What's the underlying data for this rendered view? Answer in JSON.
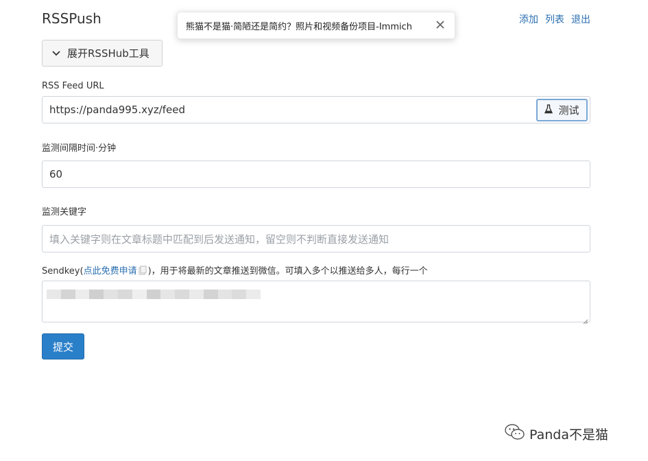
{
  "header": {
    "brand": "RSSPush",
    "nav": [
      "添加",
      "列表",
      "退出"
    ]
  },
  "toast": {
    "message": "熊猫不是猫·简陋还是简约？照片和视频备份项目-Immich"
  },
  "expand": {
    "label": "展开RSSHub工具"
  },
  "feed": {
    "label": "RSS Feed URL",
    "value": "https://panda995.xyz/feed",
    "test_label": "测试"
  },
  "interval": {
    "label": "监测间隔时间·分钟",
    "value": "60"
  },
  "keyword": {
    "label": "监测关键字",
    "placeholder": "填入关键字则在文章标题中匹配到后发送通知，留空则不判断直接发送通知"
  },
  "sendkey": {
    "label_prefix": "Sendkey(",
    "link": "点此免费申请",
    "label_suffix": ")，用于将最新的文章推送到微信。可填入多个以推送给多人，每行一个"
  },
  "submit": {
    "label": "提交"
  },
  "watermark": {
    "text": "Panda不是猫"
  },
  "icons": {
    "chevron": "chevron-down-icon",
    "flask": "flask-icon",
    "close": "close-icon",
    "external": "external-link-icon",
    "wechat": "wechat-icon"
  },
  "colors": {
    "link": "#2a6fb0",
    "primary": "#2a7fc9"
  }
}
